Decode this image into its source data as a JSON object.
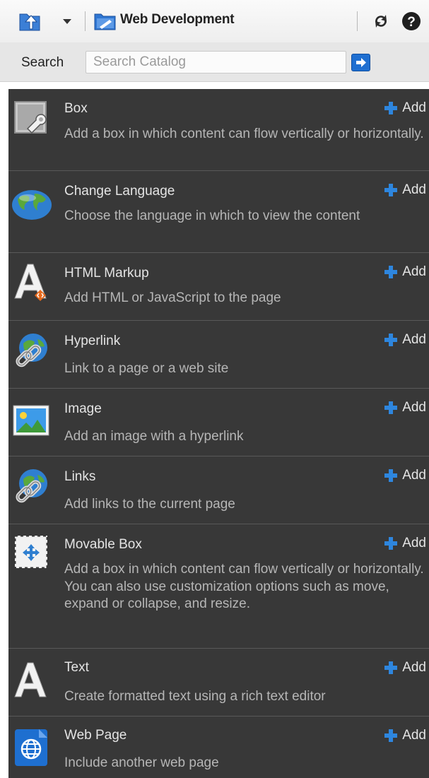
{
  "toolbar": {
    "catalog_name": "Web Development",
    "icons": [
      "navigate-up-icon",
      "dropdown-arrow-icon",
      "catalog-folder-icon",
      "refresh-icon",
      "help-icon"
    ]
  },
  "search": {
    "label": "Search",
    "placeholder": "Search Catalog",
    "value": ""
  },
  "colors": {
    "list_background": "#383838",
    "accent_blue": "#1f6fd1"
  },
  "items": [
    {
      "title": "Box",
      "description": "Add a box in which content can flow vertically or horizontally.",
      "add_label": "Add",
      "icon": "box-wrench-icon"
    },
    {
      "title": "Change Language",
      "description": "Choose the language in which to view the content",
      "add_label": "Add",
      "icon": "globe-icon"
    },
    {
      "title": "HTML Markup",
      "description": "Add HTML or JavaScript to the page",
      "add_label": "Add",
      "icon": "html-markup-icon"
    },
    {
      "title": "Hyperlink",
      "description": "Link to a page or a web site",
      "add_label": "Add",
      "icon": "hyperlink-icon"
    },
    {
      "title": "Image",
      "description": "Add an image with a hyperlink",
      "add_label": "Add",
      "icon": "image-icon"
    },
    {
      "title": "Links",
      "description": "Add links to the current page",
      "add_label": "Add",
      "icon": "links-icon"
    },
    {
      "title": "Movable Box",
      "description": "Add a box in which content can flow vertically or horizontally. You can also use customization options such as move, expand or collapse, and resize.",
      "add_label": "Add",
      "icon": "movable-box-icon"
    },
    {
      "title": "Text",
      "description": "Create formatted text using a rich text editor",
      "add_label": "Add",
      "icon": "text-icon"
    },
    {
      "title": "Web Page",
      "description": "Include another web page",
      "add_label": "Add",
      "icon": "web-page-icon"
    }
  ]
}
